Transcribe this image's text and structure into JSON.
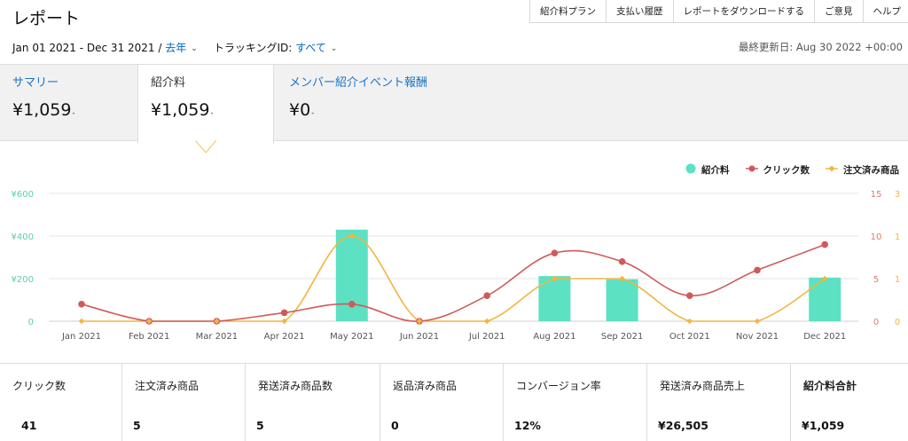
{
  "header": {
    "title": "レポート",
    "links": [
      "紹介料プラン",
      "支払い履歴",
      "レポートをダウンロードする",
      "ご意見",
      "ヘルプ"
    ],
    "date_range": "Jan 01 2021 - Dec 31 2021 /",
    "period": "去年",
    "tracking_label": "トラッキングID:",
    "tracking_value": "すべて",
    "last_updated": "最終更新日: Aug 30 2022 +00:00"
  },
  "summary": [
    {
      "label": "サマリー",
      "value": "¥1,059"
    },
    {
      "label": "紹介料",
      "value": "¥1,059"
    },
    {
      "label": "メンバー紹介イベント報酬",
      "value": "¥0"
    }
  ],
  "legend": [
    {
      "name": "紹介料",
      "color": "#5ce1c3",
      "shape": "circle"
    },
    {
      "name": "クリック数",
      "color": "#d05a5a",
      "shape": "circle"
    },
    {
      "name": "注文済み商品",
      "color": "#f2b640",
      "shape": "diamond"
    }
  ],
  "chart_data": {
    "type": "bar+line",
    "categories": [
      "Jan 2021",
      "Feb 2021",
      "Mar 2021",
      "Apr 2021",
      "May 2021",
      "Jun 2021",
      "Jul 2021",
      "Aug 2021",
      "Sep 2021",
      "Oct 2021",
      "Nov 2021",
      "Dec 2021"
    ],
    "y_left": {
      "ticks": [
        "¥600",
        "¥400",
        "¥200",
        "0"
      ],
      "range": [
        0,
        600
      ],
      "color": "#5ccfa8"
    },
    "y_right1": {
      "ticks": [
        "15",
        "10",
        "5",
        "0"
      ],
      "range": [
        0,
        15
      ],
      "color": "#e07a6a"
    },
    "y_right2": {
      "ticks": [
        "3",
        "1",
        "1",
        "0"
      ],
      "range": [
        0,
        3
      ],
      "color": "#f2b640"
    },
    "series": [
      {
        "name": "紹介料",
        "type": "bar",
        "axis": "left",
        "color": "#5ce1c3",
        "values": [
          0,
          0,
          0,
          0,
          430,
          0,
          0,
          212,
          197,
          0,
          0,
          205
        ]
      },
      {
        "name": "クリック数",
        "type": "line",
        "axis": "right1",
        "color": "#d05a5a",
        "values": [
          2,
          0,
          0,
          1,
          2,
          0,
          3,
          8,
          7,
          3,
          6,
          9
        ]
      },
      {
        "name": "注文済み商品",
        "type": "line",
        "axis": "right2",
        "color": "#f2b640",
        "values": [
          0,
          0,
          0,
          0,
          2,
          0,
          0,
          1,
          1,
          0,
          0,
          1
        ]
      }
    ],
    "grid": true,
    "legend_position": "top-right"
  },
  "stats": [
    {
      "label": "クリック数",
      "value": "41"
    },
    {
      "label": "注文済み商品",
      "value": "5"
    },
    {
      "label": "発送済み商品数",
      "value": "5"
    },
    {
      "label": "返品済み商品",
      "value": "0"
    },
    {
      "label": "コンバージョン率",
      "value": "12%"
    },
    {
      "label": "発送済み商品売上",
      "value": "¥26,505"
    },
    {
      "label": "紹介料合計",
      "value": "¥1,059"
    }
  ]
}
